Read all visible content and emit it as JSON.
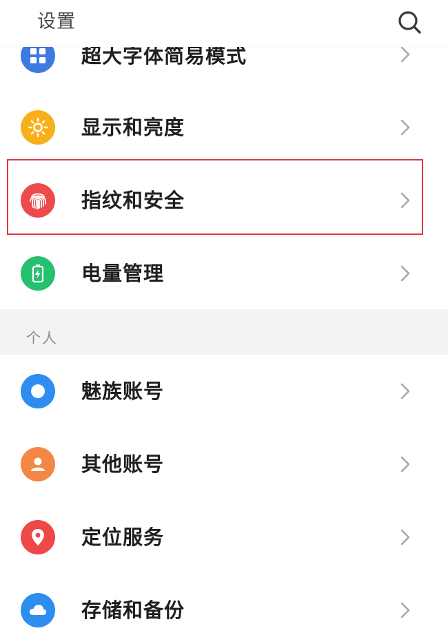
{
  "header": {
    "title": "设置",
    "search_icon": "search-icon"
  },
  "rows_top": [
    {
      "label": "超大字体简易模式",
      "icon": "grid-icon",
      "color": "#3f7ae0"
    },
    {
      "label": "显示和亮度",
      "icon": "sun-icon",
      "color": "#f7b01c"
    },
    {
      "label": "指纹和安全",
      "icon": "fingerprint-icon",
      "color": "#ec4a4d"
    },
    {
      "label": "电量管理",
      "icon": "battery-icon",
      "color": "#25c070"
    }
  ],
  "section": {
    "label": "个人"
  },
  "rows_personal": [
    {
      "label": "魅族账号",
      "icon": "account-circle-icon",
      "color": "#2f8cf0"
    },
    {
      "label": "其他账号",
      "icon": "person-icon",
      "color": "#f58745"
    },
    {
      "label": "定位服务",
      "icon": "location-pin-icon",
      "color": "#ef4848"
    },
    {
      "label": "存储和备份",
      "icon": "cloud-icon",
      "color": "#2e8ef0"
    }
  ],
  "highlight_color": "#e0383b"
}
